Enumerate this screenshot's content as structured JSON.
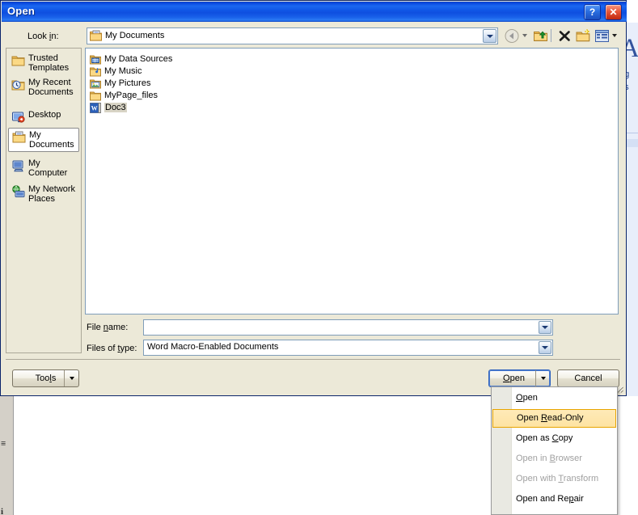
{
  "background": {
    "task_pane": {
      "big_letter": "A",
      "lines": [
        "ng",
        "es"
      ]
    },
    "gutter_marks": [
      "≡",
      "i"
    ]
  },
  "dialog": {
    "title": "Open",
    "titlebar_buttons": [
      {
        "name": "help-button",
        "glyph": "?"
      },
      {
        "name": "close-button",
        "glyph": "✕"
      }
    ],
    "lookin": {
      "label_pre": "Look ",
      "label_accel": "i",
      "label_post": "n:",
      "value": "My Documents",
      "icon": "my-documents-folder-icon"
    },
    "toolbar": [
      {
        "name": "back-button",
        "icon": "back-arrow-icon",
        "enabled": false
      },
      {
        "name": "back-dropdown",
        "icon": "chevron-down-icon",
        "enabled": false
      },
      {
        "name": "up-one-level-button",
        "icon": "up-folder-icon",
        "enabled": true
      },
      {
        "name": "delete-button",
        "icon": "delete-x-icon",
        "enabled": true
      },
      {
        "name": "create-new-folder-button",
        "icon": "new-folder-icon",
        "enabled": true
      },
      {
        "name": "views-button",
        "icon": "views-grid-icon",
        "enabled": true
      },
      {
        "name": "views-dropdown",
        "icon": "chevron-down-icon",
        "enabled": true
      }
    ],
    "places": [
      {
        "label_line1": "Trusted",
        "label_line2": "Templates",
        "icon": "trusted-templates-icon",
        "selected": false
      },
      {
        "label_line1": "My Recent",
        "label_line2": "Documents",
        "icon": "recent-documents-icon",
        "selected": false
      },
      {
        "label_line1": "Desktop",
        "label_line2": "",
        "icon": "desktop-icon",
        "selected": false
      },
      {
        "label_line1": "My",
        "label_line2": "Documents",
        "icon": "my-documents-icon",
        "selected": true
      },
      {
        "label_line1": "My",
        "label_line2": "Computer",
        "icon": "my-computer-icon",
        "selected": false
      },
      {
        "label_line1": "My Network",
        "label_line2": "Places",
        "icon": "network-places-icon",
        "selected": false
      }
    ],
    "files": [
      {
        "name": "My Data Sources",
        "icon": "data-sources-folder-icon",
        "selected": false
      },
      {
        "name": "My Music",
        "icon": "my-music-folder-icon",
        "selected": false
      },
      {
        "name": "My Pictures",
        "icon": "my-pictures-folder-icon",
        "selected": false
      },
      {
        "name": "MyPage_files",
        "icon": "folder-icon",
        "selected": false
      },
      {
        "name": "Doc3",
        "icon": "word-document-icon",
        "selected": true
      }
    ],
    "fields": {
      "filename": {
        "label_pre": "File ",
        "label_accel": "n",
        "label_post": "ame:",
        "value": "",
        "placeholder": ""
      },
      "filetype": {
        "label_pre": "Files of ",
        "label_accel": "t",
        "label_post": "ype:",
        "value": "Word Macro-Enabled Documents"
      }
    },
    "buttons": {
      "tools": {
        "pre": "Too",
        "accel": "l",
        "post": "s"
      },
      "open": {
        "pre": "",
        "accel": "O",
        "post": "pen"
      },
      "cancel": {
        "pre": "Cancel",
        "accel": "",
        "post": ""
      }
    }
  },
  "menu": {
    "items": [
      {
        "pre": "",
        "accel": "O",
        "post": "pen",
        "disabled": false,
        "highlighted": false
      },
      {
        "pre": "Open ",
        "accel": "R",
        "post": "ead-Only",
        "disabled": false,
        "highlighted": true
      },
      {
        "pre": "Open as ",
        "accel": "C",
        "post": "opy",
        "disabled": false,
        "highlighted": false
      },
      {
        "pre": "Open in ",
        "accel": "B",
        "post": "rowser",
        "disabled": true,
        "highlighted": false
      },
      {
        "pre": "Open with ",
        "accel": "T",
        "post": "ransform",
        "disabled": true,
        "highlighted": false
      },
      {
        "pre": "Open and Re",
        "accel": "p",
        "post": "air",
        "disabled": false,
        "highlighted": false
      }
    ]
  },
  "colors": {
    "title_blue": "#0b41c4",
    "dialog_face": "#ece9d8",
    "highlight_amber": "#fde3a2",
    "highlight_border": "#e8a400",
    "selection_gray": "#d8d4c5"
  }
}
